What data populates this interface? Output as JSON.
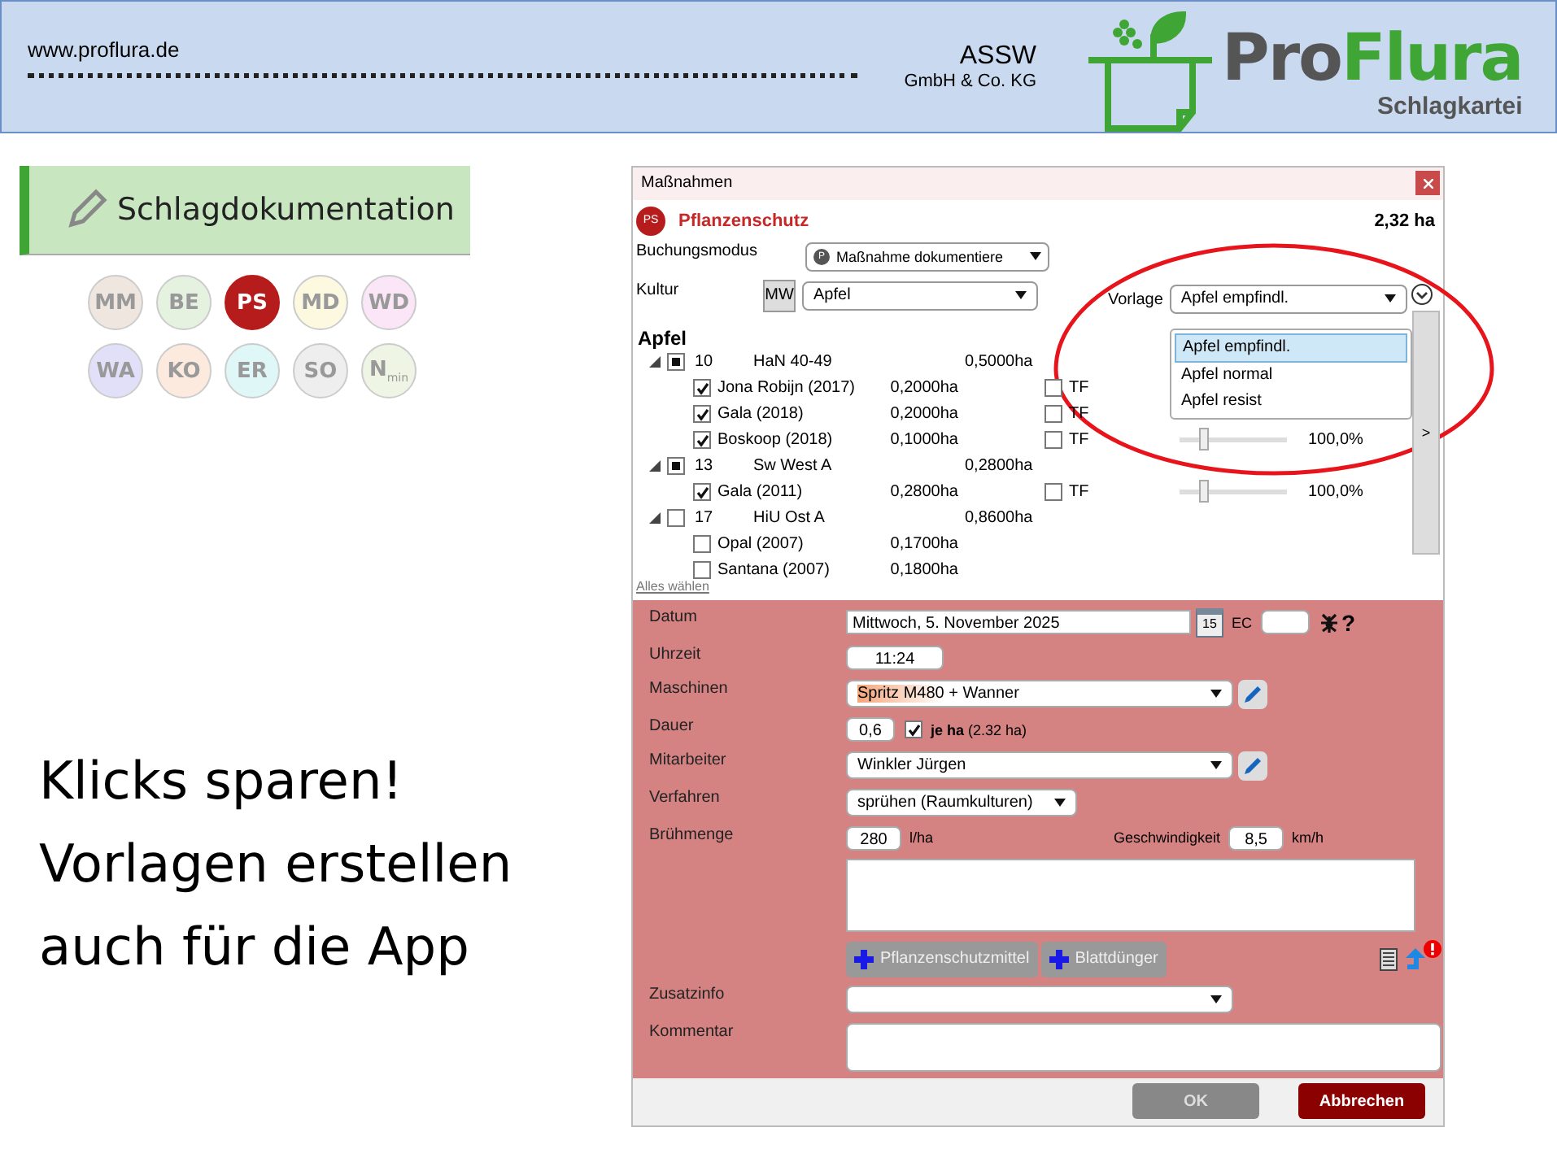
{
  "header": {
    "website": "www.proflura.de",
    "company": "ASSW",
    "company_form": "GmbH & Co. KG",
    "logo_words": [
      "Pro",
      "Flura"
    ],
    "logo_subtitle": "Schlagkartei"
  },
  "section_button": {
    "label": "Schlagdokumentation"
  },
  "categories": [
    {
      "label": "MM",
      "color": "#efe6e0",
      "selected": false
    },
    {
      "label": "BE",
      "color": "#e6f2e0",
      "selected": false
    },
    {
      "label": "PS",
      "color": "#b71c1c",
      "selected": true
    },
    {
      "label": "MD",
      "color": "#fdf8e0",
      "selected": false
    },
    {
      "label": "WD",
      "color": "#fbe6f7",
      "selected": false
    },
    {
      "label": "WA",
      "color": "#e2e0f8",
      "selected": false
    },
    {
      "label": "KO",
      "color": "#fbeadd",
      "selected": false
    },
    {
      "label": "ER",
      "color": "#e0f7f7",
      "selected": false
    },
    {
      "label": "SO",
      "color": "#eeeeee",
      "selected": false
    },
    {
      "label": "N$_{min}$",
      "color": "#eef5e4",
      "selected": false
    }
  ],
  "slogan": [
    "Klicks sparen!",
    "Vorlagen erstellen",
    "auch für die App"
  ],
  "dialog": {
    "title": "Maßnahmen",
    "badge": "PS",
    "heading": "Pflanzenschutz",
    "total_area": "2,32 ha",
    "booking_label": "Buchungsmodus",
    "booking_badge": "P",
    "booking_value": "Maßnahme dokumentiere",
    "culture_label": "Kultur",
    "culture_button": "MW",
    "culture_value": "Apfel",
    "template_label": "Vorlage",
    "template_value": "Apfel empfindl.",
    "template_options": [
      {
        "label": "Apfel empfindl.",
        "selected": true
      },
      {
        "label": "Apfel normal",
        "selected": false
      },
      {
        "label": "Apfel resist",
        "selected": false
      }
    ],
    "side_toggle": ">",
    "tree_title": "Apfel",
    "fields": [
      {
        "number": "10",
        "name": "HaN 40-49",
        "area": "0,5000ha",
        "expanded": true,
        "partial": true,
        "children": [
          {
            "name": "Jona Robijn (2017)",
            "area": "0,2000ha",
            "checked": true,
            "tf_label": "TF",
            "tf_checked": false
          },
          {
            "name": "Gala (2018)",
            "area": "0,2000ha",
            "checked": true,
            "tf_label": "TF",
            "tf_checked": false
          },
          {
            "name": "Boskoop (2018)",
            "area": "0,1000ha",
            "checked": true,
            "tf_label": "TF",
            "tf_checked": false,
            "level": 0.2,
            "share": "100,0%"
          }
        ]
      },
      {
        "number": "13",
        "name": "Sw West A",
        "area": "0,2800ha",
        "expanded": true,
        "partial": true,
        "children": [
          {
            "name": "Gala (2011)",
            "area": "0,2800ha",
            "checked": true,
            "tf_label": "TF",
            "tf_checked": false,
            "level": 0.2,
            "share": "100,0%"
          }
        ]
      },
      {
        "number": "17",
        "name": "HiU Ost A",
        "area": "0,8600ha",
        "expanded": true,
        "partial": false,
        "children": [
          {
            "name": "Opal (2007)",
            "area": "0,1700ha",
            "checked": false
          },
          {
            "name": "Santana (2007)",
            "area": "0,1800ha",
            "checked": false
          }
        ]
      }
    ],
    "select_all": "Alles wählen",
    "date_label": "Datum",
    "date_value": "Mittwoch, 5. November 2025",
    "calendar_day": "15",
    "ec_label": "EC",
    "help": "?",
    "time_label": "Uhrzeit",
    "time_value": "11:24",
    "machine_label": "Maschinen",
    "machine_highlight": "Spritz M480",
    "machine_rest": "+ Wanner",
    "duration_label": "Dauer",
    "duration_value": "0,6",
    "per_ha_checked": true,
    "per_ha_label": "**je ha** (2.32 ha)",
    "worker_label": "Mitarbeiter",
    "worker_value": "Winkler Jürgen",
    "method_label": "Verfahren",
    "method_value": "sprühen (Raumkulturen)",
    "amount_label": "Brühmenge",
    "amount_value": "280",
    "amount_unit": "l/ha",
    "speed_label": "Geschwindigkeit",
    "speed_value": "8,5",
    "speed_unit": "km/h",
    "add_buttons": [
      "Pflanzenschutzmittel",
      "Blattdünger"
    ],
    "extra_label": "Zusatzinfo",
    "comment_label": "Kommentar",
    "ok": {
      "label": "OK",
      "disabled": true
    },
    "cancel": "Abbrechen"
  }
}
